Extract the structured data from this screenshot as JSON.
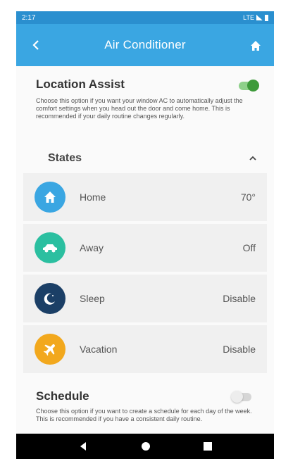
{
  "status_bar": {
    "time": "2:17",
    "indicators": "LTE"
  },
  "app_bar": {
    "title": "Air Conditioner"
  },
  "location_assist": {
    "title": "Location Assist",
    "description": "Choose this option if you want your window AC to automatically adjust the comfort settings when you head out the door and come home. This is recommended if your daily routine changes regularly.",
    "enabled": true
  },
  "states": {
    "title": "States",
    "items": [
      {
        "label": "Home",
        "value": "70°",
        "icon": "home-icon",
        "color": "#3aa6e2"
      },
      {
        "label": "Away",
        "value": "Off",
        "icon": "car-icon",
        "color": "#2bbfa0"
      },
      {
        "label": "Sleep",
        "value": "Disable",
        "icon": "moon-icon",
        "color": "#1b3f66"
      },
      {
        "label": "Vacation",
        "value": "Disable",
        "icon": "airplane-icon",
        "color": "#f2a81d"
      }
    ]
  },
  "schedule": {
    "title": "Schedule",
    "description": "Choose this option if you want to create a schedule for each day of the week. This is recommended if you have a consistent daily routine.",
    "enabled": false
  },
  "colors": {
    "header": "#3aa6e2",
    "status_bar": "#2a8fcf",
    "toggle_on": "#3d9a3a"
  }
}
